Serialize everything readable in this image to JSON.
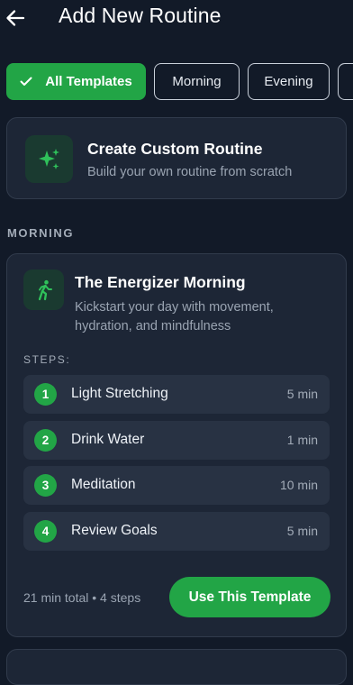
{
  "header": {
    "title": "Add New Routine",
    "back_icon": "arrow-left-icon"
  },
  "filters": [
    {
      "label": "All Templates",
      "active": true,
      "icon": "check-icon"
    },
    {
      "label": "Morning",
      "active": false
    },
    {
      "label": "Evening",
      "active": false
    },
    {
      "label": "",
      "active": false
    }
  ],
  "custom": {
    "title": "Create Custom Routine",
    "subtitle": "Build your own routine from scratch",
    "icon": "sparkles-icon"
  },
  "section": {
    "label": "MORNING"
  },
  "routine": {
    "title": "The Energizer Morning",
    "description": "Kickstart your day with movement, hydration, and mindfulness",
    "icon": "running-person-icon",
    "steps_label": "STEPS:",
    "steps": [
      {
        "num": "1",
        "name": "Light Stretching",
        "duration": "5 min"
      },
      {
        "num": "2",
        "name": "Drink Water",
        "duration": "1 min"
      },
      {
        "num": "3",
        "name": "Meditation",
        "duration": "10 min"
      },
      {
        "num": "4",
        "name": "Review Goals",
        "duration": "5 min"
      }
    ],
    "total": "21 min total • 4 steps",
    "button": "Use This Template"
  },
  "colors": {
    "accent": "#22a546",
    "background": "#121a28",
    "card": "#1d2636",
    "step_row": "#283243"
  }
}
